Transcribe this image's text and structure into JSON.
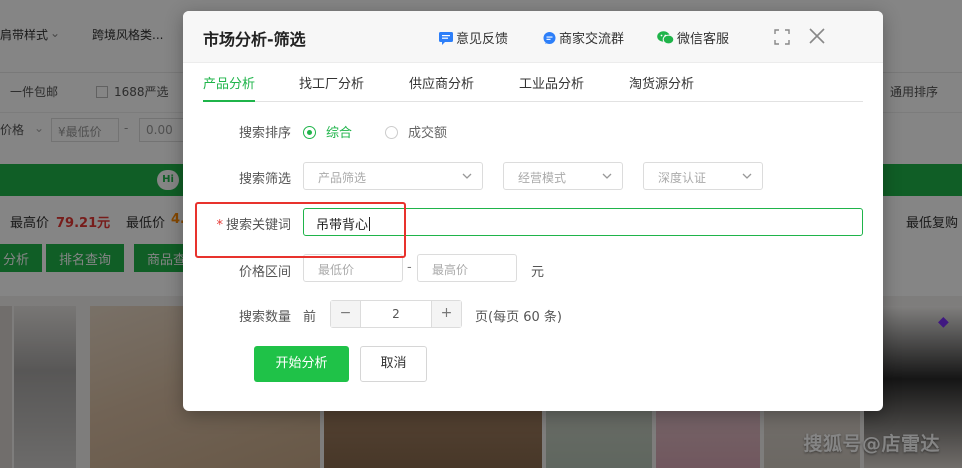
{
  "background": {
    "row1": [
      "肩带样式",
      "跨境风格类..."
    ],
    "row2": [
      "一件包邮",
      "1688严选",
      "通用排序"
    ],
    "row3": {
      "price_label": "价格",
      "min_placeholder": "¥最低价",
      "value": "0.00"
    },
    "stats": {
      "max_price_label": "最高价",
      "max_price": "79.21元",
      "min_price_label": "最低价",
      "min_price": "4.",
      "right_label": "最低复购"
    },
    "buttons": [
      "分析",
      "排名查询",
      "商品查"
    ],
    "watermark": "搜狐号@店雷达"
  },
  "modal": {
    "title": "市场分析-筛选",
    "links": {
      "feedback": "意见反馈",
      "merchant_group": "商家交流群",
      "wechat_service": "微信客服"
    },
    "tabs": [
      "产品分析",
      "找工厂分析",
      "供应商分析",
      "工业品分析",
      "淘货源分析"
    ],
    "sort": {
      "label": "搜索排序",
      "options": [
        "综合",
        "成交额"
      ]
    },
    "filter": {
      "label": "搜索筛选",
      "selects": [
        "产品筛选",
        "经营模式",
        "深度认证"
      ]
    },
    "keyword": {
      "label": "搜索关键词",
      "value": "吊带背心"
    },
    "price": {
      "label": "价格区间",
      "min_placeholder": "最低价",
      "separator": "-",
      "max_placeholder": "最高价",
      "unit": "元"
    },
    "count": {
      "label": "搜索数量",
      "prefix": "前",
      "value": "2",
      "suffix": "页(每页 60 条)"
    },
    "actions": {
      "start": "开始分析",
      "cancel": "取消"
    }
  },
  "colors": {
    "accent": "#1fb44a",
    "highlight": "#e8322d"
  }
}
